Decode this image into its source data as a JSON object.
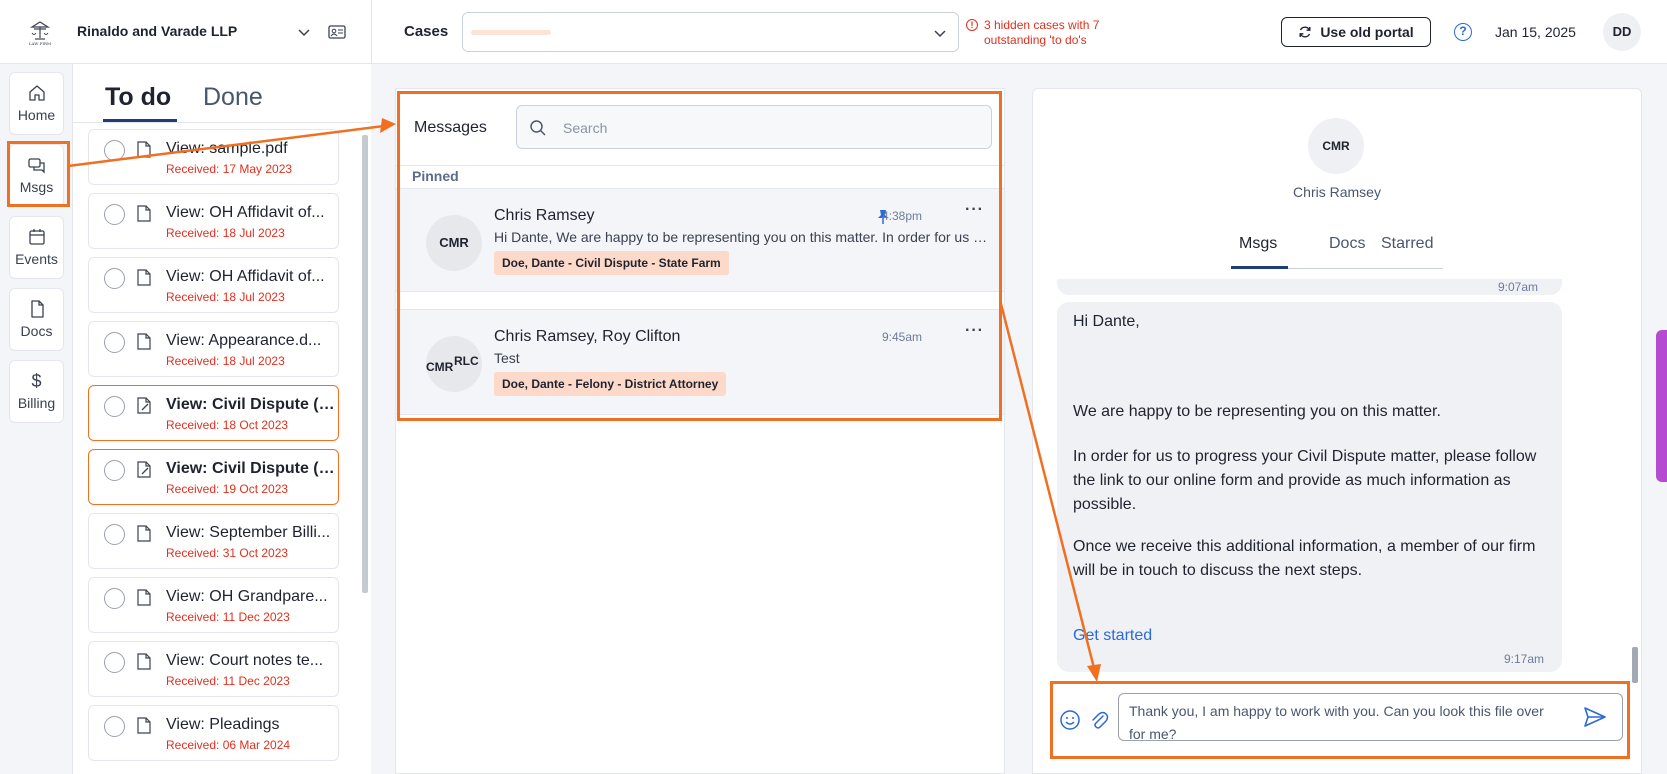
{
  "header": {
    "firm_name": "Rinaldo and Varade LLP",
    "logo_text": "LAW FIRM",
    "cases_label": "Cases",
    "hidden_cases_warning": "3 hidden cases with 7 outstanding 'to do's",
    "old_portal_label": "Use old portal",
    "date": "Jan 15, 2025",
    "user_initials": "DD"
  },
  "nav": {
    "items": [
      {
        "label": "Home",
        "icon": "home-icon"
      },
      {
        "label": "Msgs",
        "icon": "chat-icon"
      },
      {
        "label": "Events",
        "icon": "calendar-icon"
      },
      {
        "label": "Docs",
        "icon": "document-icon"
      },
      {
        "label": "Billing",
        "icon": "dollar-icon",
        "glyph": "$"
      }
    ]
  },
  "todo": {
    "tab_active": "To do",
    "tab_inactive": "Done",
    "items": [
      {
        "title": "View: sample.pdf",
        "received": "Received: 17 May 2023",
        "flag": false
      },
      {
        "title": "View: OH Affidavit of...",
        "received": "Received: 18 Jul 2023",
        "flag": false
      },
      {
        "title": "View: OH Affidavit of...",
        "received": "Received: 18 Jul 2023",
        "flag": false
      },
      {
        "title": "View: Appearance.d...",
        "received": "Received: 18 Jul 2023",
        "flag": false
      },
      {
        "title": "View: Civil Dispute (I...",
        "received": "Received: 18 Oct 2023",
        "flag": true
      },
      {
        "title": "View: Civil Dispute (I...",
        "received": "Received: 19 Oct 2023",
        "flag": true
      },
      {
        "title": "View: September Billi...",
        "received": "Received: 31 Oct 2023",
        "flag": false
      },
      {
        "title": "View: OH Grandpare...",
        "received": "Received: 11 Dec 2023",
        "flag": false
      },
      {
        "title": "View: Court notes te...",
        "received": "Received: 11 Dec 2023",
        "flag": false
      },
      {
        "title": "View: Pleadings",
        "received": "Received: 06 Mar 2024",
        "flag": false
      }
    ]
  },
  "messages": {
    "title": "Messages",
    "search_placeholder": "Search",
    "pinned_label": "Pinned",
    "threads": [
      {
        "avatar": "CMR",
        "name": "Chris Ramsey",
        "preview": "Hi Dante,   We are happy to be representing you on this matter. In order for us to progress your Civil Dispute matter",
        "tag": "Doe, Dante - Civil Dispute - State Farm",
        "time": "4:38pm",
        "pinned": true,
        "more": "···"
      },
      {
        "avatar_a": "CMR",
        "avatar_b": "RLC",
        "name": "Chris Ramsey, Roy Clifton",
        "preview": "Test",
        "tag": "Doe, Dante - Felony - District Attorney",
        "time": "9:45am",
        "pinned": false,
        "more": "···"
      }
    ]
  },
  "conversation": {
    "avatar": "CMR",
    "name": "Chris Ramsey",
    "tabs": [
      "Msgs",
      "Docs",
      "Starred"
    ],
    "prev_time": "9:07am",
    "message": {
      "greeting": "Hi Dante,",
      "p1": "We are happy to be representing you on this matter.",
      "p2": "In order for us to progress your Civil Dispute matter, please follow the link to our online form and provide as much information as possible.",
      "p3": "Once we receive this additional information, a member of our firm will be in touch to discuss the next steps.",
      "link": "Get started",
      "time": "9:17am"
    },
    "composer_value": "Thank you, I am happy to work with you. Can you look this file over for me?"
  },
  "colors": {
    "accent": "#f07022",
    "link": "#2a6ad8",
    "warning": "#e0301e",
    "tag_bg": "#fcd9c8",
    "nav_active": "#1f3d7a"
  }
}
